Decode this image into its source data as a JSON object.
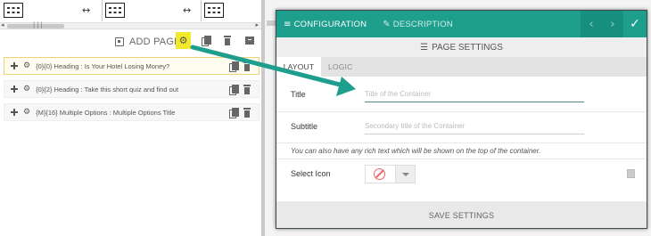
{
  "builder": {
    "add_page_label": "ADD PAGE",
    "swap_glyph": "↔",
    "gear_glyph": "⚙",
    "highlight_color": "#f2e92a",
    "pages": [
      {
        "label": "{0}{0} Heading : Is Your Hotel Losing Money?",
        "active": true
      },
      {
        "label": "{0}{2} Heading : Take this short quiz and find out",
        "active": false
      },
      {
        "label": "{M}{16} Multiple Options : Multiple Options Title",
        "active": false
      }
    ]
  },
  "modal": {
    "accent_color": "#1e9e8d",
    "tabs": [
      {
        "label": "CONFIGURATION",
        "icon": "menu-icon",
        "glyph": "≡"
      },
      {
        "label": "DESCRIPTION",
        "icon": "pen-icon",
        "glyph": "✎"
      }
    ],
    "nav_prev_glyph": "‹",
    "nav_next_glyph": "›",
    "check_glyph": "✓",
    "section_title": "PAGE SETTINGS",
    "section_glyph": "☰",
    "sub_tabs": [
      "LAYOUT",
      "LOGIC"
    ],
    "title_label": "Title",
    "title_placeholder": "Title of the Container",
    "subtitle_label": "Subtitle",
    "subtitle_placeholder": "Secondary title of the Container",
    "rich_text_note": "You can also have any rich text which will be shown on the top of the container.",
    "icon_label": "Select Icon",
    "save_label": "SAVE SETTINGS"
  }
}
